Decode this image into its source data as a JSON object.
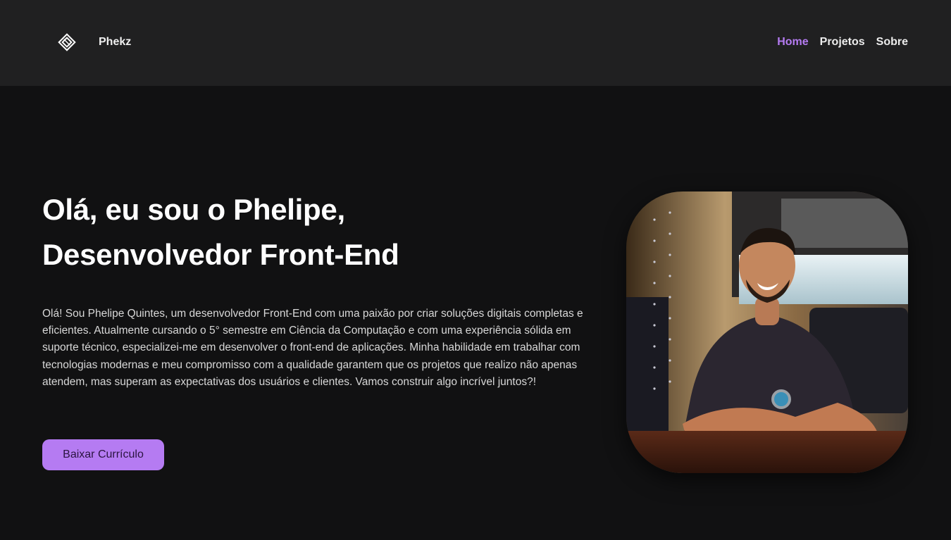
{
  "header": {
    "brand": "Phekz",
    "logo_icon": "diamond-logo-icon",
    "nav": [
      {
        "label": "Home",
        "active": true
      },
      {
        "label": "Projetos",
        "active": false
      },
      {
        "label": "Sobre",
        "active": false
      }
    ]
  },
  "hero": {
    "title_line1": "Olá, eu sou o Phelipe,",
    "title_line2": "Desenvolvedor Front-End",
    "description": "Olá! Sou Phelipe Quintes, um desenvolvedor Front-End com uma paixão por criar soluções digitais completas e eficientes. Atualmente cursando o 5° semestre em Ciência da Computação e com uma experiência sólida em suporte técnico, especializei-me em desenvolver o front-end de aplicações. Minha habilidade em trabalhar com tecnologias modernas e meu compromisso com a qualidade garantem que os projetos que realizo não apenas atendem, mas superam as expectativas dos usuários e clientes. Vamos construir algo incrível juntos?!",
    "button_label": "Baixar Currículo"
  },
  "colors": {
    "accent": "#b57bf2",
    "background": "#111112",
    "navbar": "#202021"
  }
}
